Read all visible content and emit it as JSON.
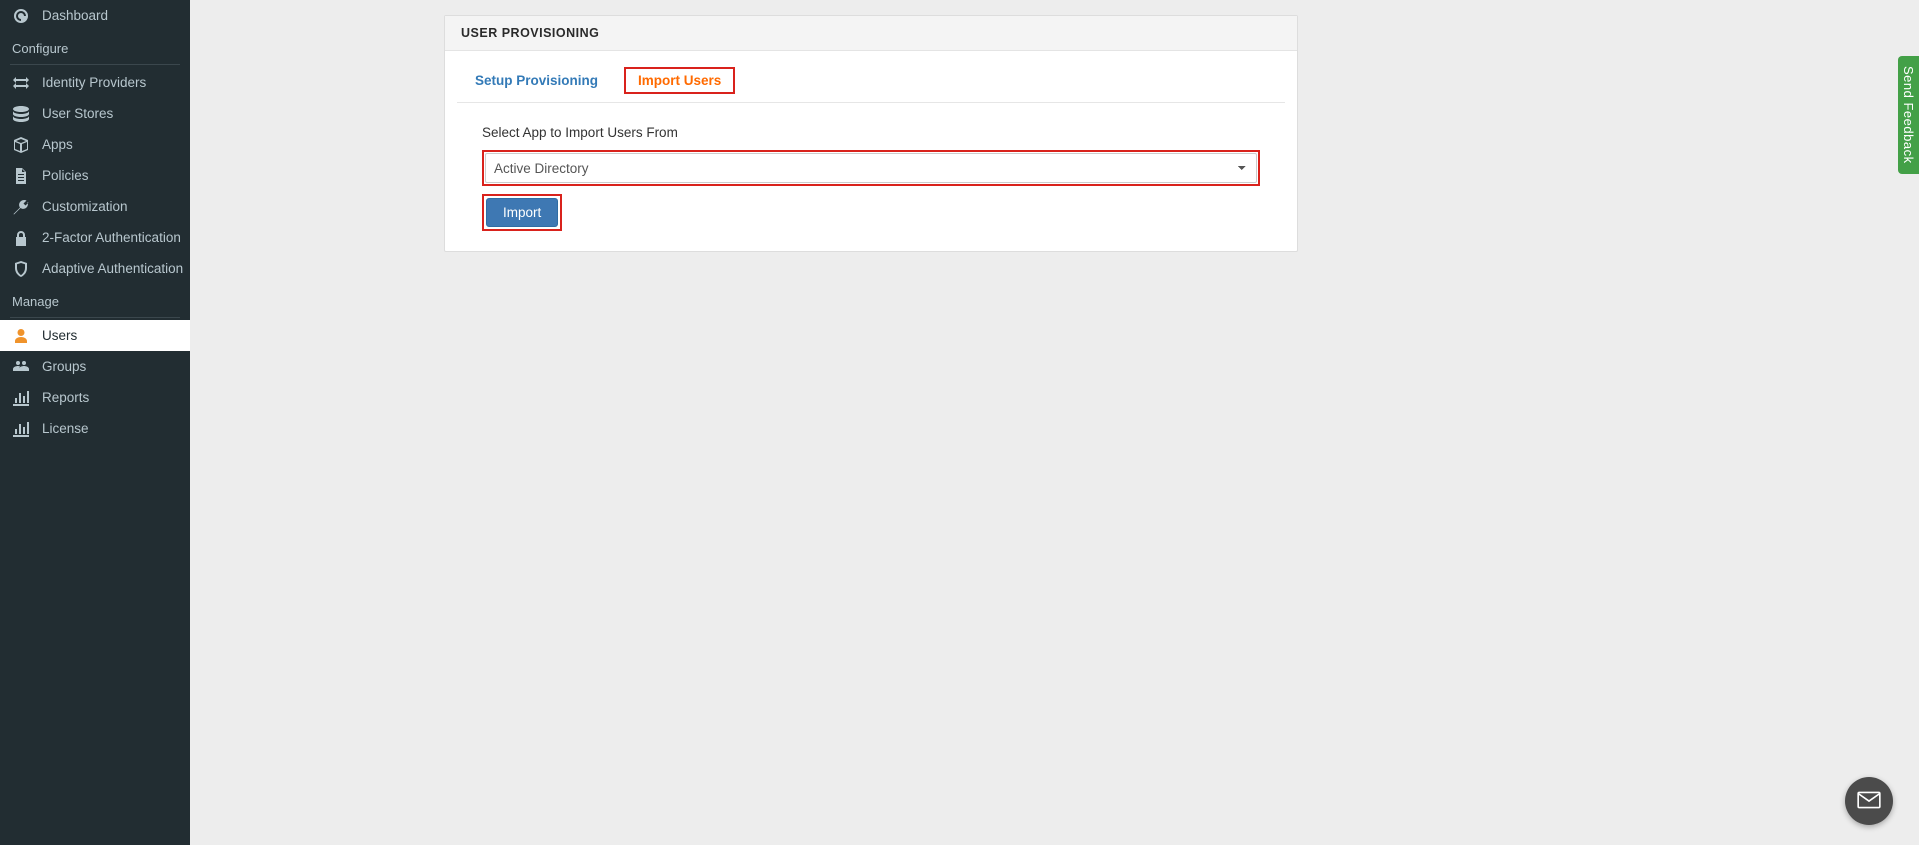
{
  "sidebar": {
    "dashboard": {
      "label": "Dashboard"
    },
    "sections": {
      "configure": {
        "title": "Configure",
        "items": [
          {
            "key": "identity-providers",
            "label": "Identity Providers"
          },
          {
            "key": "user-stores",
            "label": "User Stores"
          },
          {
            "key": "apps",
            "label": "Apps"
          },
          {
            "key": "policies",
            "label": "Policies"
          },
          {
            "key": "customization",
            "label": "Customization"
          },
          {
            "key": "two-factor",
            "label": "2-Factor Authentication"
          },
          {
            "key": "adaptive-auth",
            "label": "Adaptive Authentication"
          }
        ]
      },
      "manage": {
        "title": "Manage",
        "items": [
          {
            "key": "users",
            "label": "Users",
            "active": true
          },
          {
            "key": "groups",
            "label": "Groups"
          },
          {
            "key": "reports",
            "label": "Reports"
          },
          {
            "key": "license",
            "label": "License"
          }
        ]
      }
    }
  },
  "panel": {
    "title": "USER PROVISIONING",
    "tabs": {
      "setup": {
        "label": "Setup Provisioning"
      },
      "import": {
        "label": "Import Users"
      }
    },
    "form": {
      "select_label": "Select App to Import Users From",
      "selected_value": "Active Directory",
      "import_button": "Import"
    }
  },
  "feedback": {
    "label": "Send Feedback"
  },
  "colors": {
    "sidebar_bg": "#222d32",
    "accent_orange": "#ff6a00",
    "link_blue": "#337ab7",
    "highlight_red": "#d9221c",
    "feedback_green": "#43a047",
    "button_blue": "#3e78b3"
  }
}
